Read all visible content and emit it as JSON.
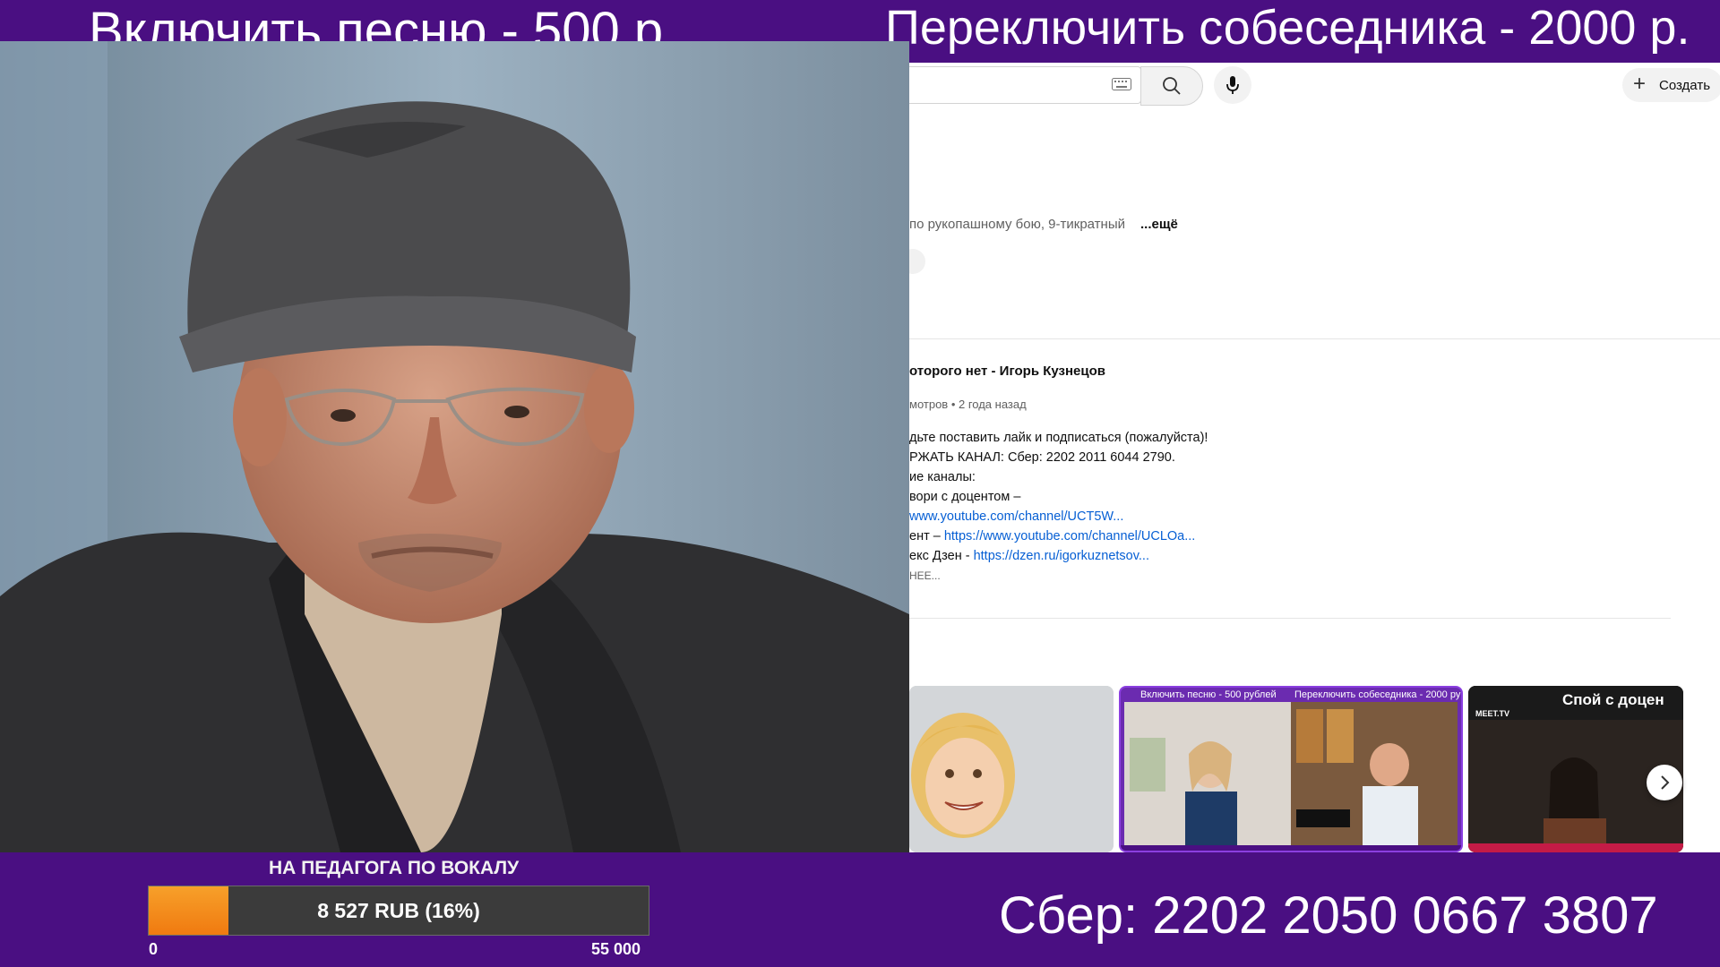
{
  "overlay": {
    "banner_left": "Включить песню - 500 р.",
    "banner_right": "Переключить собеседника - 2000 р.",
    "bg_color": "#4a0f82"
  },
  "browser": {
    "header": {
      "keyboard_icon": "keyboard-icon",
      "search_icon": "search-icon",
      "mic_icon": "microphone-icon",
      "create_label": "Создать"
    },
    "channel": {
      "description": "по рукопашному бою, 9-тикратный",
      "more": "...ещё"
    },
    "video": {
      "title": "оторого нет - Игорь Кузнецов",
      "meta": "мотров • 2 года назад",
      "description_lines": [
        {
          "text": "дьте поставить лайк и подписаться (пожалуйста)!",
          "link": ""
        },
        {
          "text": "РЖАТЬ КАНАЛ: Сбер: 2202 2011 6044 2790.",
          "link": ""
        },
        {
          "text": "ие каналы:",
          "link": ""
        },
        {
          "text": "вори с доцентом –",
          "link": ""
        },
        {
          "text": "",
          "link": "www.youtube.com/channel/UCT5W..."
        },
        {
          "text": "ент – ",
          "link": "https://www.youtube.com/channel/UCLOa..."
        },
        {
          "text": "екс Дзен - ",
          "link": "https://dzen.ru/igorkuznetsov..."
        },
        {
          "text": "НЕЕ...",
          "link": ""
        }
      ]
    },
    "thumbnails": [
      {
        "label": ""
      },
      {
        "banner_left": "Включить песню - 500 рублей",
        "banner_right": "Переключить собеседника - 2000 рублей"
      },
      {
        "title": "Спой с доцен",
        "brand": "MEET.TV"
      }
    ],
    "carousel_next_icon": "chevron-right-icon"
  },
  "goal": {
    "title": "НА ПЕДАГОГА ПО ВОКАЛУ",
    "progress_text": "8 527 RUB (16%)",
    "current": 8527,
    "target": 55000,
    "fraction": 0.16,
    "min_label": "0",
    "max_label": "55 000",
    "fill_color": "#f48a1a"
  },
  "sber": "Сбер: 2202 2050 0667 3807"
}
